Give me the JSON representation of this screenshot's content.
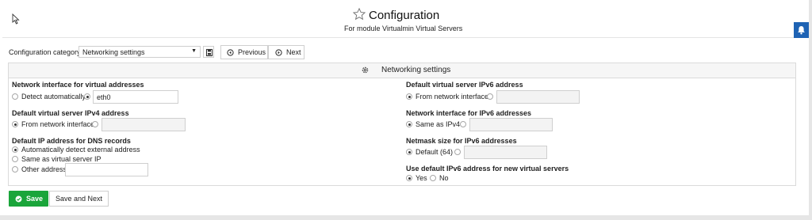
{
  "header": {
    "title": "Configuration",
    "subtitle": "For module Virtualmin Virtual Servers"
  },
  "toolbar": {
    "category_label": "Configuration category:",
    "category_value": "Networking settings",
    "previous_label": "Previous",
    "next_label": "Next"
  },
  "panel": {
    "title": "Networking settings"
  },
  "left": {
    "iface": {
      "label": "Network interface for virtual addresses",
      "opt_auto": "Detect automatically",
      "value": "eth0"
    },
    "ipv4": {
      "label": "Default virtual server IPv4 address",
      "opt_from_iface": "From network interface",
      "value": ""
    },
    "dns": {
      "label": "Default IP address for DNS records",
      "opt_auto": "Automatically detect external address",
      "opt_same": "Same as virtual server IP",
      "opt_other": "Other address",
      "value": ""
    }
  },
  "right": {
    "ipv6": {
      "label": "Default virtual server IPv6 address",
      "opt_from_iface": "From network interface",
      "value": ""
    },
    "iface6": {
      "label": "Network interface for IPv6 addresses",
      "opt_same": "Same as IPv4",
      "value": ""
    },
    "netmask6": {
      "label": "Netmask size for IPv6 addresses",
      "opt_default": "Default (64)",
      "value": ""
    },
    "use_default6": {
      "label": "Use default IPv6 address for new virtual servers",
      "opt_yes": "Yes",
      "opt_no": "No"
    }
  },
  "actions": {
    "save_label": "Save",
    "save_next_label": "Save and Next"
  },
  "icons": {
    "star": "star-icon",
    "bell": "bell-icon",
    "gear": "gear-icon",
    "save": "save-icon",
    "prev": "previous-icon",
    "next": "next-icon",
    "check": "check-icon"
  },
  "colors": {
    "save_green": "#1aa53a",
    "bell_blue": "#1e63b4"
  }
}
